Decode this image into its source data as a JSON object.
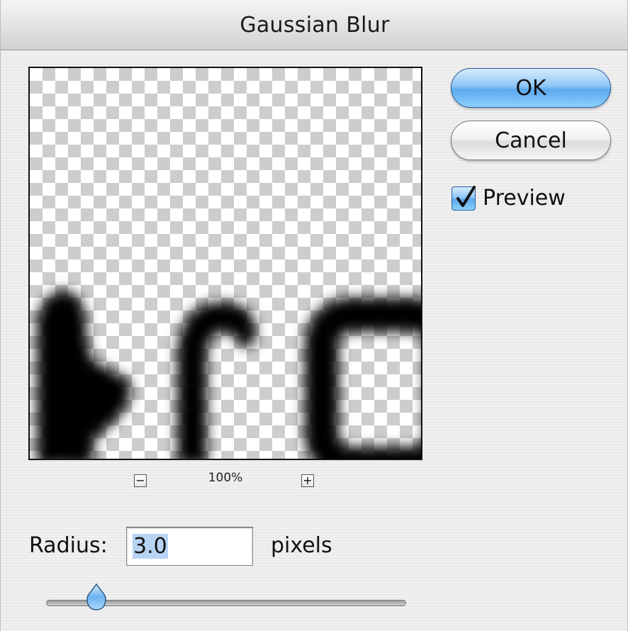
{
  "window": {
    "title": "Gaussian Blur"
  },
  "buttons": {
    "ok_label": "OK",
    "cancel_label": "Cancel"
  },
  "preview_checkbox": {
    "label": "Preview",
    "checked": true
  },
  "zoom": {
    "level": "100%",
    "minus_symbol": "−",
    "plus_symbol": "+"
  },
  "radius": {
    "label": "Radius:",
    "value": "3.0",
    "unit": "pixels",
    "slider_fraction": 0.14
  },
  "colors": {
    "ok_accent": "#5aa9ee",
    "selection": "#b7d4f4"
  },
  "icons": {
    "checkmark": "checkmark-icon",
    "slider_thumb": "slider-thumb-icon"
  }
}
